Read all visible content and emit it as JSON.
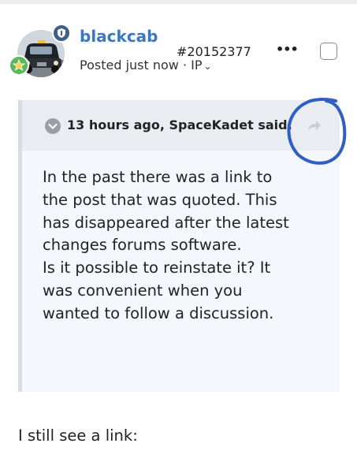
{
  "post": {
    "username": "blackcab",
    "post_number": "#20152377",
    "posted_text": "Posted just now · IP",
    "ip_chevron": "⌄",
    "more_glyph": "•••",
    "avatar_icon": "taxi-cab-photo",
    "badges": {
      "moderator_icon": "shield-icon",
      "star_icon": "star-icon",
      "moderator_color": "#3f5f86",
      "star_color": "#5cb85c"
    }
  },
  "quote": {
    "citation": "13 hours ago, SpaceKadet said:",
    "toggle_icon": "chevron-down-icon",
    "share_icon": "share-arrow-icon",
    "lines": [
      "In the past there was a link to",
      "the post that was quoted. This",
      "has disappeared after the latest",
      "changes forums software.",
      "Is it possible to reinstate it? It",
      "was convenient when you",
      "wanted to follow a discussion."
    ]
  },
  "reply": {
    "text": "I still see a link:"
  },
  "colors": {
    "username": "#3b78c4",
    "annotation": "#2f5fc4",
    "quote_bg": "#f4f7fb",
    "quote_header_bg": "#e9edf2"
  }
}
